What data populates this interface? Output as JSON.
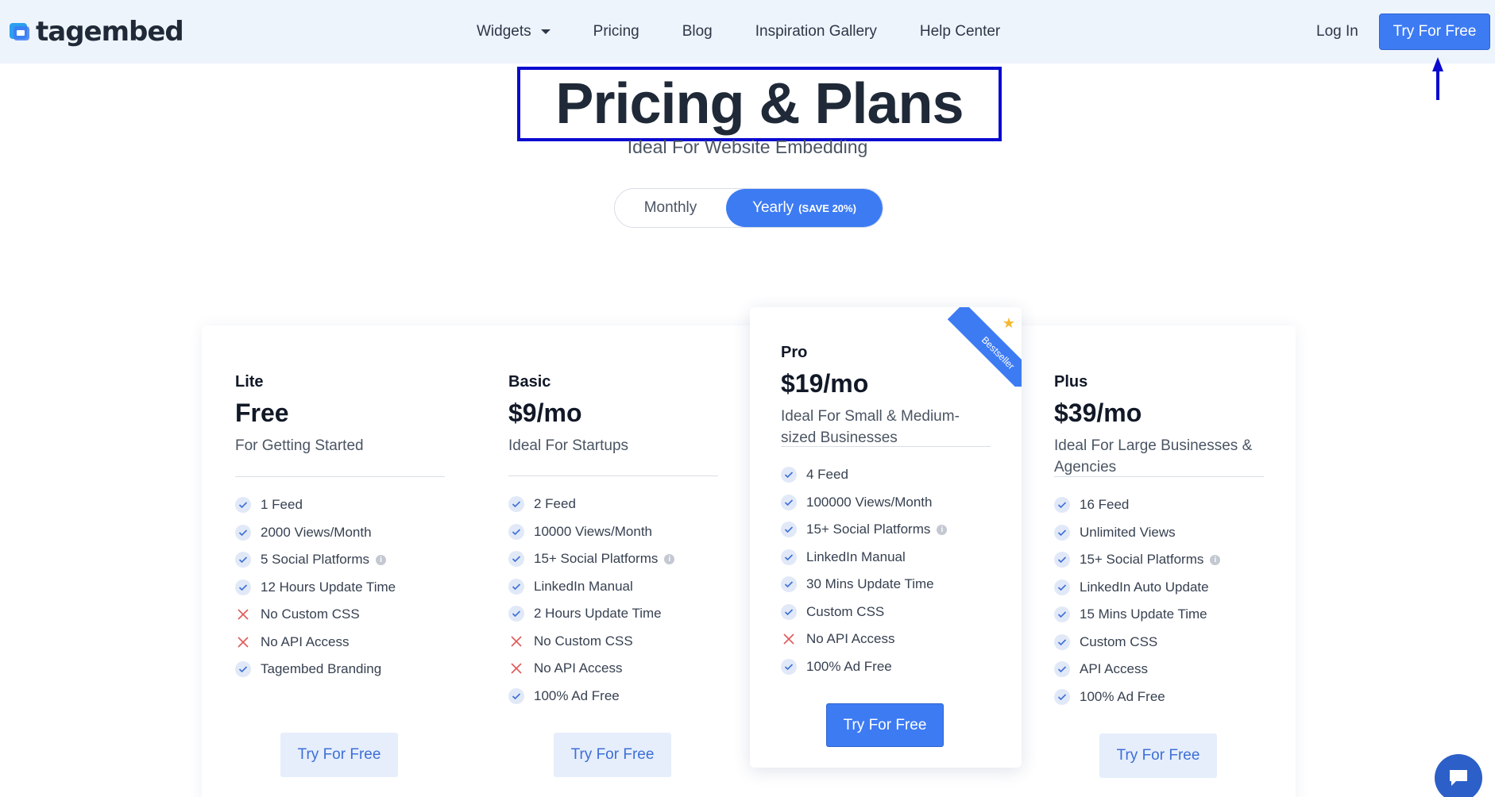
{
  "nav": {
    "logo_text": "tagembed",
    "links": [
      {
        "label": "Widgets",
        "has_dropdown": true
      },
      {
        "label": "Pricing"
      },
      {
        "label": "Blog"
      },
      {
        "label": "Inspiration Gallery"
      },
      {
        "label": "Help Center"
      }
    ],
    "login": "Log In",
    "cta": "Try For Free"
  },
  "hero": {
    "title": "Pricing & Plans",
    "subtitle": "Ideal For Website Embedding",
    "toggle": {
      "monthly": "Monthly",
      "yearly": "Yearly",
      "save_badge": "(SAVE 20%)",
      "selected": "yearly"
    }
  },
  "plans": [
    {
      "name": "Lite",
      "price": "Free",
      "desc": "For Getting Started",
      "features": [
        {
          "text": "1 Feed",
          "included": true
        },
        {
          "text": "2000 Views/Month",
          "included": true
        },
        {
          "text": "5 Social Platforms",
          "included": true,
          "info": true
        },
        {
          "text": "12 Hours Update Time",
          "included": true
        },
        {
          "text": "No Custom CSS",
          "included": false
        },
        {
          "text": "No API Access",
          "included": false
        },
        {
          "text": "Tagembed Branding",
          "included": true
        }
      ],
      "button": "Try For Free"
    },
    {
      "name": "Basic",
      "price": "$9/mo",
      "desc": "Ideal For Startups",
      "features": [
        {
          "text": "2 Feed",
          "included": true
        },
        {
          "text": "10000 Views/Month",
          "included": true
        },
        {
          "text": "15+ Social Platforms",
          "included": true,
          "info": true
        },
        {
          "text": "LinkedIn Manual",
          "included": true
        },
        {
          "text": "2 Hours Update Time",
          "included": true
        },
        {
          "text": "No Custom CSS",
          "included": false
        },
        {
          "text": "No API Access",
          "included": false
        },
        {
          "text": "100% Ad Free",
          "included": true
        }
      ],
      "button": "Try For Free"
    },
    {
      "name": "Pro",
      "price": "$19/mo",
      "desc": "Ideal For Small & Medium-sized Businesses",
      "ribbon": "Bestseller",
      "features": [
        {
          "text": "4 Feed",
          "included": true
        },
        {
          "text": "100000 Views/Month",
          "included": true
        },
        {
          "text": "15+ Social Platforms",
          "included": true,
          "info": true
        },
        {
          "text": "LinkedIn Manual",
          "included": true
        },
        {
          "text": "30 Mins Update Time",
          "included": true
        },
        {
          "text": "Custom CSS",
          "included": true
        },
        {
          "text": "No API Access",
          "included": false
        },
        {
          "text": "100% Ad Free",
          "included": true
        }
      ],
      "button": "Try For Free"
    },
    {
      "name": "Plus",
      "price": "$39/mo",
      "desc": "Ideal For Large Businesses & Agencies",
      "features": [
        {
          "text": "16 Feed",
          "included": true
        },
        {
          "text": "Unlimited Views",
          "included": true
        },
        {
          "text": "15+ Social Platforms",
          "included": true,
          "info": true
        },
        {
          "text": "LinkedIn Auto Update",
          "included": true
        },
        {
          "text": "15 Mins Update Time",
          "included": true
        },
        {
          "text": "Custom CSS",
          "included": true
        },
        {
          "text": "API Access",
          "included": true
        },
        {
          "text": "100% Ad Free",
          "included": true
        }
      ],
      "button": "Try For Free"
    }
  ],
  "colors": {
    "accent": "#3d7bf3",
    "nav_bg": "#eef4fc",
    "highlight_box": "#0a0ad0",
    "cross": "#e05a5a",
    "star": "#f5b82e"
  }
}
